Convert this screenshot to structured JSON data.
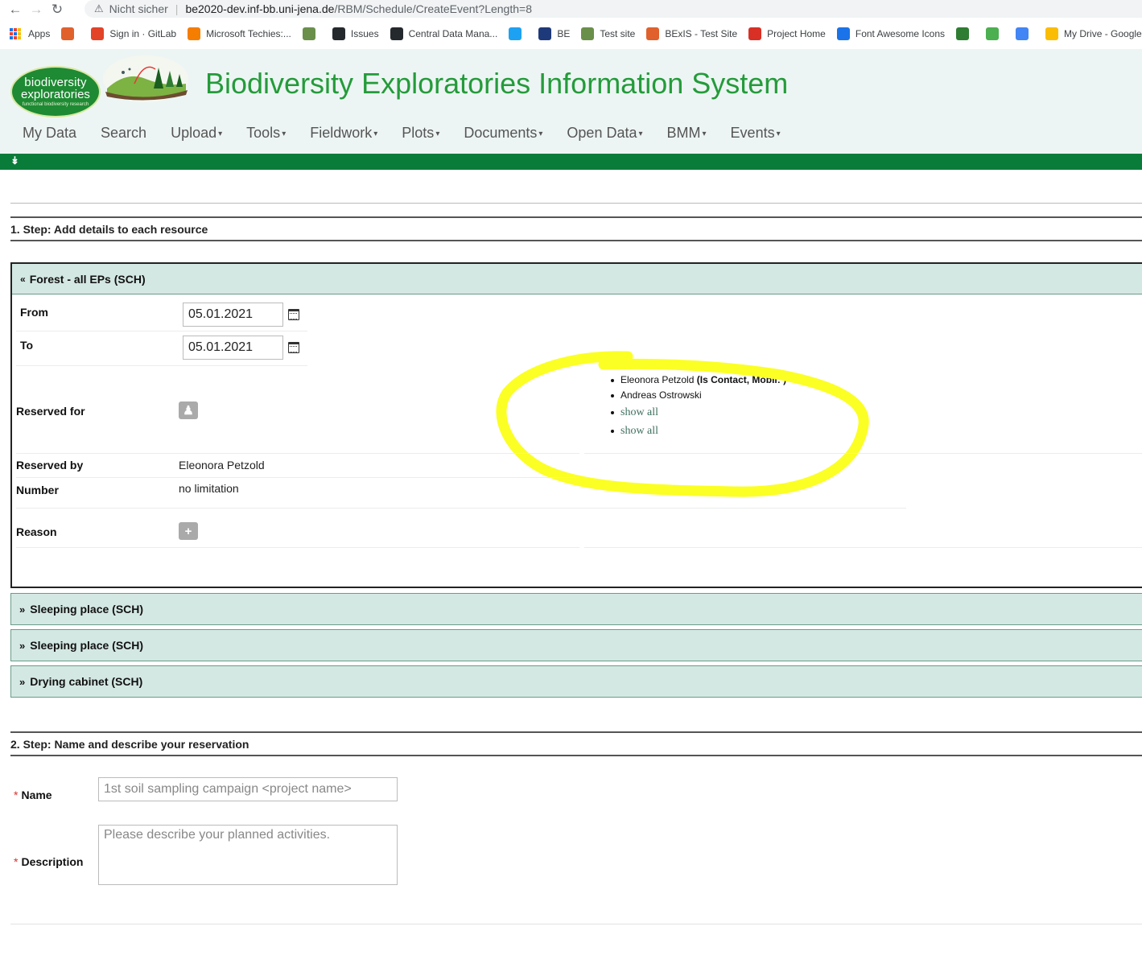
{
  "browser": {
    "not_secure": "Nicht sicher",
    "url_host": "be2020-dev.inf-bb.uni-jena.de",
    "url_path": "/RBM/Schedule/CreateEvent?Length=8",
    "bookmarks": [
      {
        "label": "Apps",
        "color": "#1a73e8"
      },
      {
        "label": "",
        "color": "#e0612c"
      },
      {
        "label": "Sign in · GitLab",
        "color": "#e24329"
      },
      {
        "label": "Microsoft Techies:...",
        "color": "#f57d00"
      },
      {
        "label": "",
        "color": "#6a8f4a"
      },
      {
        "label": "Issues",
        "color": "#24292e"
      },
      {
        "label": "Central Data Mana...",
        "color": "#24292e"
      },
      {
        "label": "",
        "color": "#1da1f2"
      },
      {
        "label": "BE",
        "color": "#1f3a7a"
      },
      {
        "label": "Test site",
        "color": "#6a8f4a"
      },
      {
        "label": "BExIS - Test Site",
        "color": "#e0612c"
      },
      {
        "label": "Project Home",
        "color": "#d93025"
      },
      {
        "label": "Font Awesome Icons",
        "color": "#1a73e8"
      },
      {
        "label": "",
        "color": "#2e7d32"
      },
      {
        "label": "",
        "color": "#4caf50"
      },
      {
        "label": "",
        "color": "#4285f4"
      },
      {
        "label": "My Drive - Google...",
        "color": "#fbbc04"
      }
    ]
  },
  "header": {
    "logo_line1": "biodiversity",
    "logo_line2": "exploratories",
    "logo_line3": "functional biodiversity research",
    "title": "Biodiversity Exploratories Information System",
    "menu": [
      {
        "label": "My Data",
        "dropdown": false
      },
      {
        "label": "Search",
        "dropdown": false
      },
      {
        "label": "Upload",
        "dropdown": true
      },
      {
        "label": "Tools",
        "dropdown": true
      },
      {
        "label": "Fieldwork",
        "dropdown": true
      },
      {
        "label": "Plots",
        "dropdown": true
      },
      {
        "label": "Documents",
        "dropdown": true
      },
      {
        "label": "Open Data",
        "dropdown": true
      },
      {
        "label": "BMM",
        "dropdown": true
      },
      {
        "label": "Events",
        "dropdown": true
      }
    ],
    "accent_color": "#0a7c3a"
  },
  "step1": {
    "title": "1. Step: Add details to each resource",
    "open_panel": {
      "title": "Forest - all EPs (SCH)",
      "from_label": "From",
      "from_value": "05.01.2021",
      "to_label": "To",
      "to_value": "05.01.2021",
      "reserved_for_label": "Reserved for",
      "persons": [
        {
          "name": "Eleonora Petzold",
          "note": "(Is Contact, Mobil: )"
        },
        {
          "name": "Andreas Ostrowski",
          "note": ""
        }
      ],
      "show_all_1": "show all",
      "show_all_2": "show all",
      "reserved_by_label": "Reserved by",
      "reserved_by_value": "Eleonora Petzold",
      "number_label": "Number",
      "number_value": "no limitation",
      "reason_label": "Reason"
    },
    "collapsed_panels": [
      {
        "title": "Sleeping place (SCH)"
      },
      {
        "title": "Sleeping place (SCH)"
      },
      {
        "title": "Drying cabinet (SCH)"
      }
    ]
  },
  "step2": {
    "title": "2. Step: Name and describe your reservation",
    "name_label": "Name",
    "name_placeholder": "1st soil sampling campaign <project name>",
    "description_label": "Description",
    "description_placeholder": "Please describe your planned activities.",
    "required_mark": "*"
  }
}
